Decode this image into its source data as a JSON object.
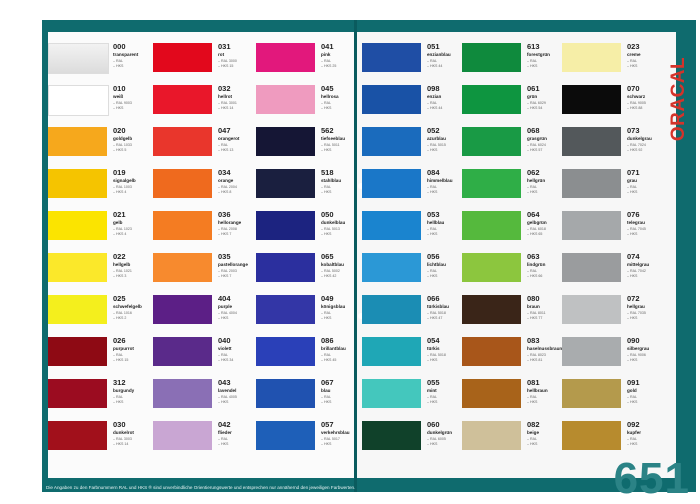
{
  "brand": {
    "name": "ORACAL",
    "series": "651"
  },
  "footnote": "Die Angaben zu den Farbnummern RAL und HKS ® sind unverbindliche Orientierungswerte und entsprechen nur annähernd den jeweiligen Farbwerten.",
  "colors": [
    {
      "code": "000",
      "name": "transparent",
      "ral": "– RAL",
      "hks": "– HKS",
      "color": "#e8e8e8",
      "col": 0,
      "row": 0
    },
    {
      "code": "010",
      "name": "weiß",
      "ral": "– RAL 9003",
      "hks": "– HKS",
      "color": "#ffffff",
      "col": 0,
      "row": 1
    },
    {
      "code": "020",
      "name": "goldgelb",
      "ral": "– RAL 1033",
      "hks": "– HKS 5",
      "color": "#f6a81c",
      "col": 0,
      "row": 2
    },
    {
      "code": "019",
      "name": "signalgelb",
      "ral": "– RAL 1003",
      "hks": "– HKS 4",
      "color": "#f5c400",
      "col": 0,
      "row": 3
    },
    {
      "code": "021",
      "name": "gelb",
      "ral": "– RAL 1023",
      "hks": "– HKS 4",
      "color": "#fbe400",
      "col": 0,
      "row": 4
    },
    {
      "code": "022",
      "name": "hellgelb",
      "ral": "– RAL 1021",
      "hks": "– HKS 3",
      "color": "#fbe82a",
      "col": 0,
      "row": 5
    },
    {
      "code": "025",
      "name": "schwefelgelb",
      "ral": "– RAL 1016",
      "hks": "– HKS 2",
      "color": "#f4ef1d",
      "col": 0,
      "row": 6
    },
    {
      "code": "026",
      "name": "purpurrot",
      "ral": "– RAL",
      "hks": "– HKS 15",
      "color": "#8e0a14",
      "col": 0,
      "row": 7
    },
    {
      "code": "312",
      "name": "burgundy",
      "ral": "– RAL",
      "hks": "– HKS",
      "color": "#9b0c20",
      "col": 0,
      "row": 8
    },
    {
      "code": "030",
      "name": "dunkelrot",
      "ral": "– RAL 3003",
      "hks": "– HKS 14",
      "color": "#a1101b",
      "col": 0,
      "row": 9
    },
    {
      "code": "031",
      "name": "rot",
      "ral": "– RAL 3000",
      "hks": "– HKS 15",
      "color": "#e2081c",
      "col": 1,
      "row": 0
    },
    {
      "code": "032",
      "name": "hellrot",
      "ral": "– RAL 3001",
      "hks": "– HKS 14",
      "color": "#e9172a",
      "col": 1,
      "row": 1
    },
    {
      "code": "047",
      "name": "orangerot",
      "ral": "– RAL",
      "hks": "– HKS 13",
      "color": "#e9362c",
      "col": 1,
      "row": 2
    },
    {
      "code": "034",
      "name": "orange",
      "ral": "– RAL 2004",
      "hks": "– HKS 8",
      "color": "#ef6a1e",
      "col": 1,
      "row": 3
    },
    {
      "code": "036",
      "name": "hellorange",
      "ral": "– RAL 2008",
      "hks": "– HKS 7",
      "color": "#f47c22",
      "col": 1,
      "row": 4
    },
    {
      "code": "035",
      "name": "pastellorange",
      "ral": "– RAL 2003",
      "hks": "– HKS 7",
      "color": "#f78a2e",
      "col": 1,
      "row": 5
    },
    {
      "code": "404",
      "name": "purple",
      "ral": "– RAL 4004",
      "hks": "– HKS",
      "color": "#5c1f86",
      "col": 1,
      "row": 6
    },
    {
      "code": "040",
      "name": "violett",
      "ral": "– RAL",
      "hks": "– HKS 34",
      "color": "#5a2a8a",
      "col": 1,
      "row": 7
    },
    {
      "code": "043",
      "name": "lavendel",
      "ral": "– RAL 4005",
      "hks": "– HKS",
      "color": "#8a6fb5",
      "col": 1,
      "row": 8
    },
    {
      "code": "042",
      "name": "flieder",
      "ral": "– RAL",
      "hks": "– HKS",
      "color": "#c9a6d3",
      "col": 1,
      "row": 9
    },
    {
      "code": "041",
      "name": "pink",
      "ral": "– RAL",
      "hks": "– HKS 25",
      "color": "#e2187c",
      "col": 2,
      "row": 0
    },
    {
      "code": "045",
      "name": "hellrosa",
      "ral": "– RAL",
      "hks": "– HKS",
      "color": "#ef9bbf",
      "col": 2,
      "row": 1
    },
    {
      "code": "562",
      "name": "tiefseeblau",
      "ral": "– RAL 5011",
      "hks": "– HKS",
      "color": "#151635",
      "col": 2,
      "row": 2
    },
    {
      "code": "518",
      "name": "stahlblau",
      "ral": "– RAL",
      "hks": "– HKS",
      "color": "#1a1f3f",
      "col": 2,
      "row": 3
    },
    {
      "code": "050",
      "name": "dunkelblau",
      "ral": "– RAL 5013",
      "hks": "– HKS",
      "color": "#1c2380",
      "col": 2,
      "row": 4
    },
    {
      "code": "065",
      "name": "kobaltblau",
      "ral": "– RAL 5002",
      "hks": "– HKS 42",
      "color": "#2b2f9e",
      "col": 2,
      "row": 5
    },
    {
      "code": "049",
      "name": "königsblau",
      "ral": "– RAL",
      "hks": "– HKS",
      "color": "#3336a6",
      "col": 2,
      "row": 6
    },
    {
      "code": "086",
      "name": "brillantblau",
      "ral": "– RAL",
      "hks": "– HKS 45",
      "color": "#2a40b8",
      "col": 2,
      "row": 7
    },
    {
      "code": "067",
      "name": "blau",
      "ral": "– RAL",
      "hks": "– HKS",
      "color": "#2052b0",
      "col": 2,
      "row": 8
    },
    {
      "code": "057",
      "name": "verkehrsblau",
      "ral": "– RAL 5017",
      "hks": "– HKS",
      "color": "#1e5fb8",
      "col": 2,
      "row": 9
    },
    {
      "code": "051",
      "name": "enzianblau",
      "ral": "– RAL",
      "hks": "– HKS 44",
      "color": "#1f4ea5",
      "col": 3,
      "row": 0
    },
    {
      "code": "098",
      "name": "enzian",
      "ral": "– RAL",
      "hks": "– HKS 44",
      "color": "#1952a6",
      "col": 3,
      "row": 1
    },
    {
      "code": "052",
      "name": "azurblau",
      "ral": "– RAL 5015",
      "hks": "– HKS",
      "color": "#1a6bbd",
      "col": 3,
      "row": 2
    },
    {
      "code": "084",
      "name": "himmelblau",
      "ral": "– RAL",
      "hks": "– HKS",
      "color": "#1a77c8",
      "col": 3,
      "row": 3
    },
    {
      "code": "053",
      "name": "hellblau",
      "ral": "– RAL",
      "hks": "– HKS",
      "color": "#1a84cf",
      "col": 3,
      "row": 4
    },
    {
      "code": "056",
      "name": "lichtblau",
      "ral": "– RAL",
      "hks": "– HKS",
      "color": "#2b98d6",
      "col": 3,
      "row": 5
    },
    {
      "code": "066",
      "name": "türkisblau",
      "ral": "– RAL 5018",
      "hks": "– HKS 47",
      "color": "#1b8db4",
      "col": 3,
      "row": 6
    },
    {
      "code": "054",
      "name": "türkis",
      "ral": "– RAL 5018",
      "hks": "– HKS",
      "color": "#1fa7b6",
      "col": 3,
      "row": 7
    },
    {
      "code": "055",
      "name": "mint",
      "ral": "– RAL",
      "hks": "– HKS",
      "color": "#44c7bd",
      "col": 3,
      "row": 8
    },
    {
      "code": "060",
      "name": "dunkelgrün",
      "ral": "– RAL 6005",
      "hks": "– HKS",
      "color": "#10412a",
      "col": 3,
      "row": 9
    },
    {
      "code": "613",
      "name": "forestgrün",
      "ral": "– RAL",
      "hks": "– HKS",
      "color": "#0f8a3d",
      "col": 4,
      "row": 0
    },
    {
      "code": "061",
      "name": "grün",
      "ral": "– RAL 6029",
      "hks": "– HKS 54",
      "color": "#0e9540",
      "col": 4,
      "row": 1
    },
    {
      "code": "068",
      "name": "grasgrün",
      "ral": "– RAL 6024",
      "hks": "– HKS 57",
      "color": "#199a45",
      "col": 4,
      "row": 2
    },
    {
      "code": "062",
      "name": "hellgrün",
      "ral": "– RAL",
      "hks": "– HKS",
      "color": "#2fae47",
      "col": 4,
      "row": 3
    },
    {
      "code": "064",
      "name": "gelbgrün",
      "ral": "– RAL 6018",
      "hks": "– HKS 65",
      "color": "#55b93d",
      "col": 4,
      "row": 4
    },
    {
      "code": "063",
      "name": "lindgrün",
      "ral": "– RAL",
      "hks": "– HKS 66",
      "color": "#8cc63e",
      "col": 4,
      "row": 5
    },
    {
      "code": "080",
      "name": "braun",
      "ral": "– RAL 8011",
      "hks": "– HKS 77",
      "color": "#3a2518",
      "col": 4,
      "row": 6
    },
    {
      "code": "083",
      "name": "haselnussbraun",
      "ral": "– RAL 8023",
      "hks": "– HKS 81",
      "color": "#a8561a",
      "col": 4,
      "row": 7
    },
    {
      "code": "081",
      "name": "hellbraun",
      "ral": "– RAL",
      "hks": "– HKS",
      "color": "#a8631a",
      "col": 4,
      "row": 8
    },
    {
      "code": "082",
      "name": "beige",
      "ral": "– RAL",
      "hks": "– HKS",
      "color": "#cfc09a",
      "col": 4,
      "row": 9
    },
    {
      "code": "023",
      "name": "creme",
      "ral": "– RAL",
      "hks": "– HKS",
      "color": "#f6eea7",
      "col": 5,
      "row": 0
    },
    {
      "code": "070",
      "name": "schwarz",
      "ral": "– RAL 9005",
      "hks": "– HKS 88",
      "color": "#0b0b0b",
      "col": 5,
      "row": 1
    },
    {
      "code": "073",
      "name": "dunkelgrau",
      "ral": "– RAL 7024",
      "hks": "– HKS 92",
      "color": "#53585b",
      "col": 5,
      "row": 2
    },
    {
      "code": "071",
      "name": "grau",
      "ral": "– RAL",
      "hks": "– HKS",
      "color": "#8b8e90",
      "col": 5,
      "row": 3
    },
    {
      "code": "076",
      "name": "telegrau",
      "ral": "– RAL 7045",
      "hks": "– HKS",
      "color": "#a5a8aa",
      "col": 5,
      "row": 4
    },
    {
      "code": "074",
      "name": "mittelgrau",
      "ral": "– RAL 7042",
      "hks": "– HKS",
      "color": "#9a9c9e",
      "col": 5,
      "row": 5
    },
    {
      "code": "072",
      "name": "hellgrau",
      "ral": "– RAL 7035",
      "hks": "– HKS",
      "color": "#bfc1c2",
      "col": 5,
      "row": 6
    },
    {
      "code": "090",
      "name": "silbergrau",
      "ral": "– RAL 9006",
      "hks": "– HKS",
      "color": "#a9acae",
      "col": 5,
      "row": 7
    },
    {
      "code": "091",
      "name": "gold",
      "ral": "– RAL",
      "hks": "– HKS",
      "color": "#b49a4c",
      "col": 5,
      "row": 8
    },
    {
      "code": "092",
      "name": "kupfer",
      "ral": "– RAL",
      "hks": "– HKS",
      "color": "#b78b2e",
      "col": 5,
      "row": 9
    }
  ]
}
